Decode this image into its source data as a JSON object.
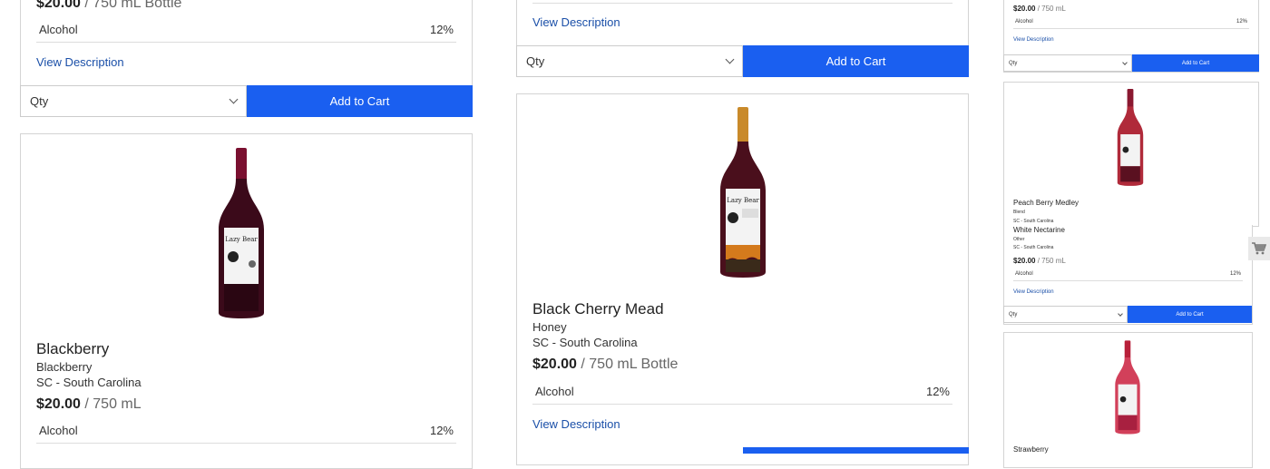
{
  "common": {
    "qty_label": "Qty",
    "add_to_cart": "Add to Cart",
    "view_description": "View Description",
    "alcohol_label": "Alcohol",
    "alcohol_value": "12%",
    "price": "$20.00",
    "unit_bottle": " / 750 mL Bottle",
    "unit_plain": " / 750 mL"
  },
  "left_column": {
    "blackberry": {
      "name": "Blackberry",
      "type": "Blackberry",
      "region": "SC - South Carolina"
    }
  },
  "middle_column": {
    "black_cherry": {
      "name": "Black Cherry Mead",
      "type": "Honey",
      "region": "SC - South Carolina"
    }
  },
  "right_column": {
    "peach_berry": {
      "name": "Peach Berry Medley",
      "type": "Blend",
      "region": "SC - South Carolina"
    },
    "white_nectarine": {
      "name": "White Nectarine",
      "type": "Other",
      "region": "SC - South Carolina"
    },
    "strawberry": {
      "name": "Strawberry"
    }
  },
  "colors": {
    "primary_button": "#1a5ff0",
    "link": "#1a4fa8",
    "border": "#d4d4d4"
  },
  "icons": [
    "chevron-down-icon",
    "cart-icon",
    "wine-bottle-image"
  ]
}
